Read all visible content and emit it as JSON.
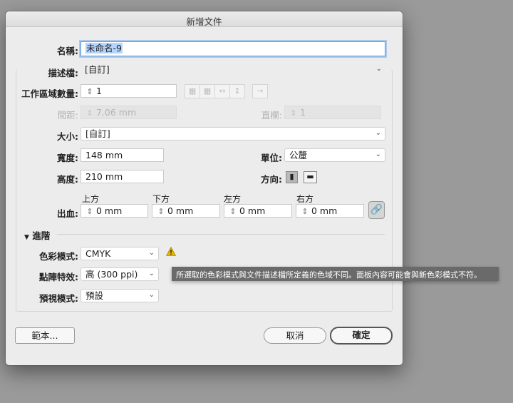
{
  "dialog": {
    "title": "新增文件"
  },
  "name": {
    "label": "名稱:",
    "value": "未命名-9"
  },
  "profile": {
    "label": "描述檔:",
    "value": "[自訂]"
  },
  "artboards": {
    "label": "工作區域數量:",
    "value": "1"
  },
  "spacing": {
    "label": "間距:",
    "value": "7.06 mm"
  },
  "columns": {
    "label": "直欄:",
    "value": "1"
  },
  "size": {
    "label": "大小:",
    "value": "[自訂]"
  },
  "width": {
    "label": "寬度:",
    "value": "148 mm"
  },
  "units": {
    "label": "單位:",
    "value": "公釐"
  },
  "height": {
    "label": "高度:",
    "value": "210 mm"
  },
  "orientation": {
    "label": "方向:",
    "selected": "portrait"
  },
  "bleed": {
    "label": "出血:",
    "top": {
      "label": "上方",
      "value": "0 mm"
    },
    "bottom": {
      "label": "下方",
      "value": "0 mm"
    },
    "left": {
      "label": "左方",
      "value": "0 mm"
    },
    "right": {
      "label": "右方",
      "value": "0 mm"
    }
  },
  "advanced": {
    "label": "進階",
    "color_mode": {
      "label": "色彩模式:",
      "value": "CMYK"
    },
    "raster": {
      "label": "點陣特效:",
      "value": "高 (300 ppi)"
    },
    "preview": {
      "label": "預視模式:",
      "value": "預設"
    }
  },
  "warning": {
    "tooltip": "所選取的色彩模式與文件描述檔所定義的色域不同。面板內容可能會與新色彩模式不符。",
    "color": "#e8b400"
  },
  "buttons": {
    "templates": "範本...",
    "cancel": "取消",
    "ok": "確定"
  },
  "icons": {
    "artboard_arrange": [
      "grid-by-row-icon",
      "grid-by-column-icon",
      "arrange-by-row-icon",
      "arrange-by-column-icon",
      "change-to-rtl-icon"
    ],
    "link": "chain-link-icon"
  }
}
